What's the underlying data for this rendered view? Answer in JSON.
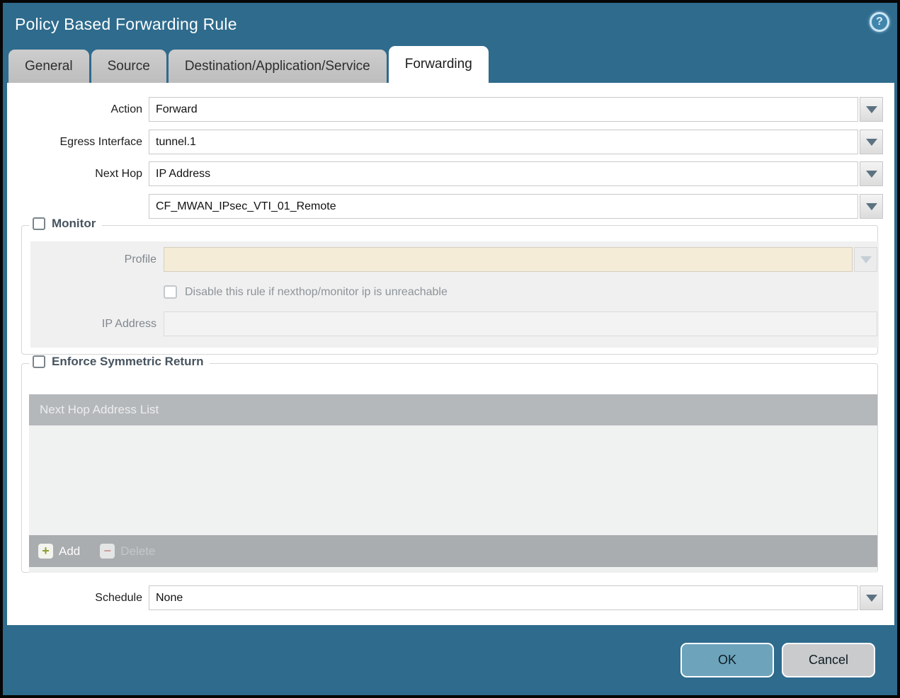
{
  "window": {
    "title": "Policy Based Forwarding Rule"
  },
  "tabs": [
    {
      "label": "General",
      "active": false
    },
    {
      "label": "Source",
      "active": false
    },
    {
      "label": "Destination/Application/Service",
      "active": false
    },
    {
      "label": "Forwarding",
      "active": true
    }
  ],
  "form": {
    "action": {
      "label": "Action",
      "value": "Forward"
    },
    "egress_interface": {
      "label": "Egress Interface",
      "value": "tunnel.1"
    },
    "next_hop": {
      "label": "Next Hop",
      "value": "IP Address"
    },
    "next_hop_address": {
      "value": "CF_MWAN_IPsec_VTI_01_Remote"
    },
    "schedule": {
      "label": "Schedule",
      "value": "None"
    }
  },
  "monitor": {
    "legend": "Monitor",
    "checked": false,
    "profile": {
      "label": "Profile",
      "value": ""
    },
    "disable_rule": {
      "label": "Disable this rule if nexthop/monitor ip is unreachable",
      "checked": false
    },
    "ip_address": {
      "label": "IP Address",
      "value": ""
    }
  },
  "symmetric_return": {
    "legend": "Enforce Symmetric Return",
    "checked": false,
    "table_header": "Next Hop Address List",
    "rows": [],
    "add_label": "Add",
    "delete_label": "Delete",
    "delete_enabled": false
  },
  "footer": {
    "ok_label": "OK",
    "cancel_label": "Cancel"
  },
  "icons": {
    "help": "question-mark-icon",
    "dropdown": "chevron-down-icon",
    "add": "plus-icon",
    "delete": "minus-icon",
    "help_glyph": "?",
    "add_glyph": "+",
    "delete_glyph": "−"
  },
  "colors": {
    "chrome_teal": "#2e6b8d",
    "ok_button": "#6da4bc",
    "cancel_button": "#c9cbcd",
    "disabled_field_beige": "#f5ecd7",
    "table_header_gray": "#b5b8ba",
    "add_plus_green": "#8a9e33",
    "delete_minus_red": "#d09a9a"
  }
}
